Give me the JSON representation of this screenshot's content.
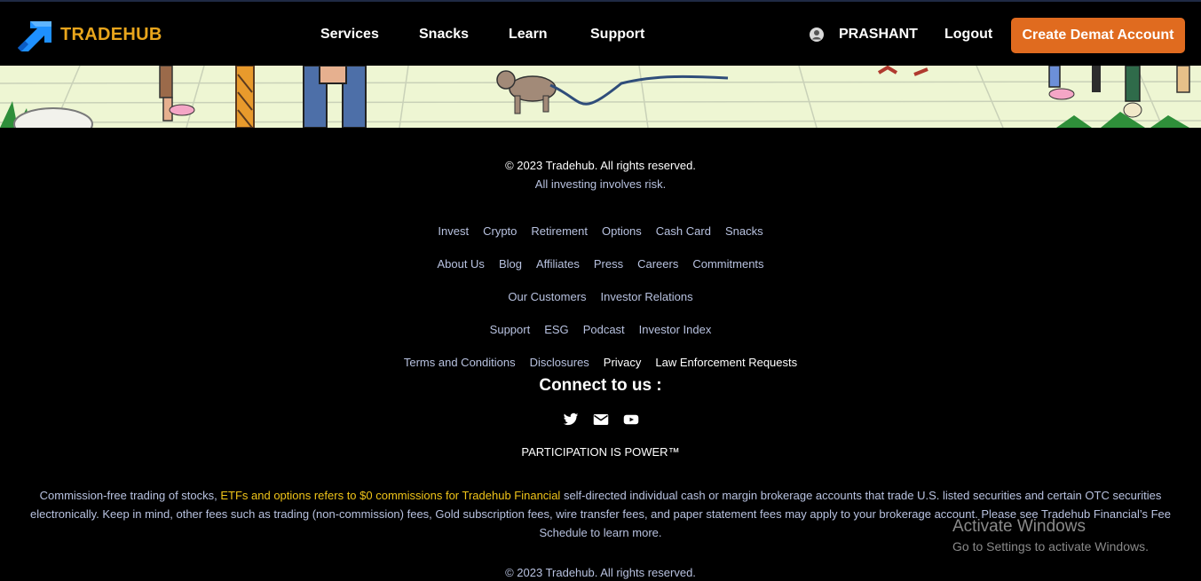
{
  "brand": {
    "name": "TRADEHUB",
    "accent": "#e8a51c"
  },
  "nav": {
    "links": [
      "Services",
      "Snacks",
      "Learn",
      "Support"
    ],
    "user_name": "PRASHANT",
    "logout": "Logout",
    "cta": "Create Demat Account",
    "cta_color": "#e06b1f"
  },
  "footer": {
    "copyright": "© 2023 Tradehub. All rights reserved.",
    "risk_note": "All investing involves risk.",
    "link_rows": [
      [
        "Invest",
        "Crypto",
        "Retirement",
        "Options",
        "Cash Card",
        "Snacks"
      ],
      [
        "About Us",
        "Blog",
        "Affiliates",
        "Press",
        "Careers",
        "Commitments"
      ],
      [
        "Our Customers",
        "Investor Relations"
      ],
      [
        "Support",
        "ESG",
        "Podcast",
        "Investor Index"
      ],
      [
        "Terms and Conditions",
        "Disclosures",
        "Privacy",
        "Law Enforcement Requests"
      ]
    ],
    "connect_title": "Connect to us :",
    "social_icons": [
      "twitter-icon",
      "email-icon",
      "youtube-icon"
    ],
    "participation": "PARTICIPATION IS POWER™",
    "disclaimer": {
      "part1": "Commission-free trading of stocks, ",
      "highlight": "ETFs and options refers to $0 commissions for Tradehub Financial",
      "part2": " self-directed individual cash or margin brokerage accounts that trade U.S. listed securities and certain OTC securities electronically. Keep in mind, other fees such as trading (non-commission) fees, Gold subscription fees, wire transfer fees, and paper statement fees may apply to your brokerage account. Please see Tradehub Financial’s Fee Schedule to learn more."
    },
    "copyright_bottom": "© 2023 Tradehub. All rights reserved."
  },
  "os_watermark": {
    "title": "Activate Windows",
    "subtitle": "Go to Settings to activate Windows."
  }
}
